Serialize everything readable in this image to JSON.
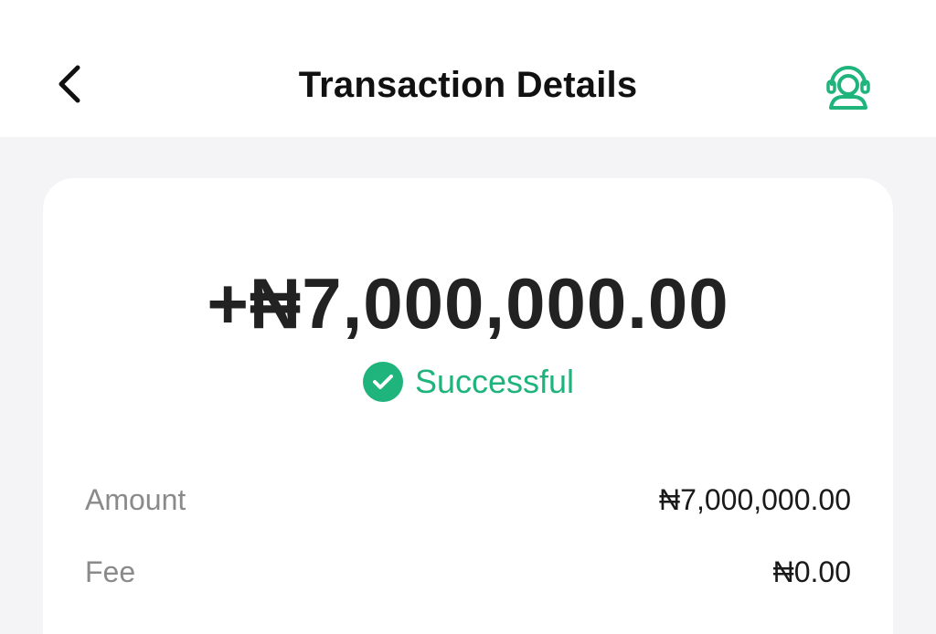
{
  "header": {
    "title": "Transaction Details",
    "back_icon": "chevron-left-icon",
    "support_icon": "customer-support-icon"
  },
  "summary": {
    "amount": "+₦7,000,000.00",
    "status": "Successful",
    "status_icon": "check-circle-icon"
  },
  "details": [
    {
      "label": "Amount",
      "value": "₦7,000,000.00"
    },
    {
      "label": "Fee",
      "value": "₦0.00"
    }
  ],
  "colors": {
    "accent": "#1fb47b",
    "background": "#f4f4f6",
    "card": "#ffffff"
  }
}
